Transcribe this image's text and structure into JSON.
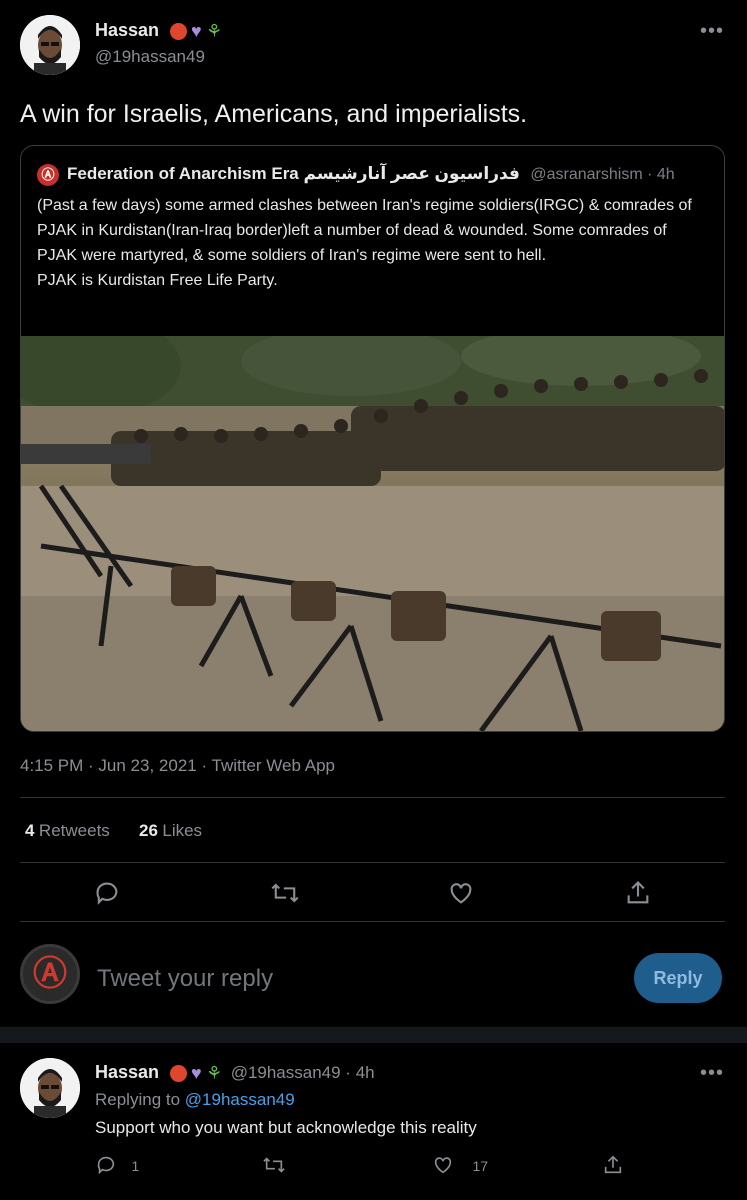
{
  "main_tweet": {
    "author_name": "Hassan",
    "author_handle": "@19hassan49",
    "more_label": "•••",
    "text": "A win for Israelis, Americans, and imperialists.",
    "timestamp": "4:15 PM · Jun 23, 2021 · Twitter Web App",
    "retweets_count": "4",
    "retweets_label": "Retweets",
    "likes_count": "26",
    "likes_label": "Likes"
  },
  "quoted_tweet": {
    "logo_char": "Ⓐ",
    "author_name": "Federation of Anarchism Era فدراسیون عصر آنارشیسم",
    "author_handle": "@asranarshism",
    "age": "· 4h",
    "text": "(Past a few days) some armed clashes between Iran's regime soldiers(IRGC) & comrades of PJAK in Kurdistan(Iran-Iraq border)left a number of dead & wounded. Some comrades of PJAK were martyred, & some soldiers of Iran's regime were sent to hell.\nPJAK is Kurdistan Free Life Party."
  },
  "reply_composer": {
    "avatar_char": "Ⓐ",
    "placeholder": "Tweet your reply",
    "button_label": "Reply"
  },
  "reply_tweet": {
    "author_name": "Hassan",
    "author_handle": "@19hassan49 · 4h",
    "more_label": "•••",
    "replying_label": "Replying to",
    "replying_handle": "@19hassan49",
    "text": "Support who you want but acknowledge this reality",
    "reply_count": "1",
    "like_count": "17"
  },
  "icons": [
    "reply-icon",
    "retweet-icon",
    "like-icon",
    "share-icon"
  ],
  "colors": {
    "accent": "#1d9bf0",
    "reply_button": "#1f5e8c",
    "background": "#000000"
  }
}
